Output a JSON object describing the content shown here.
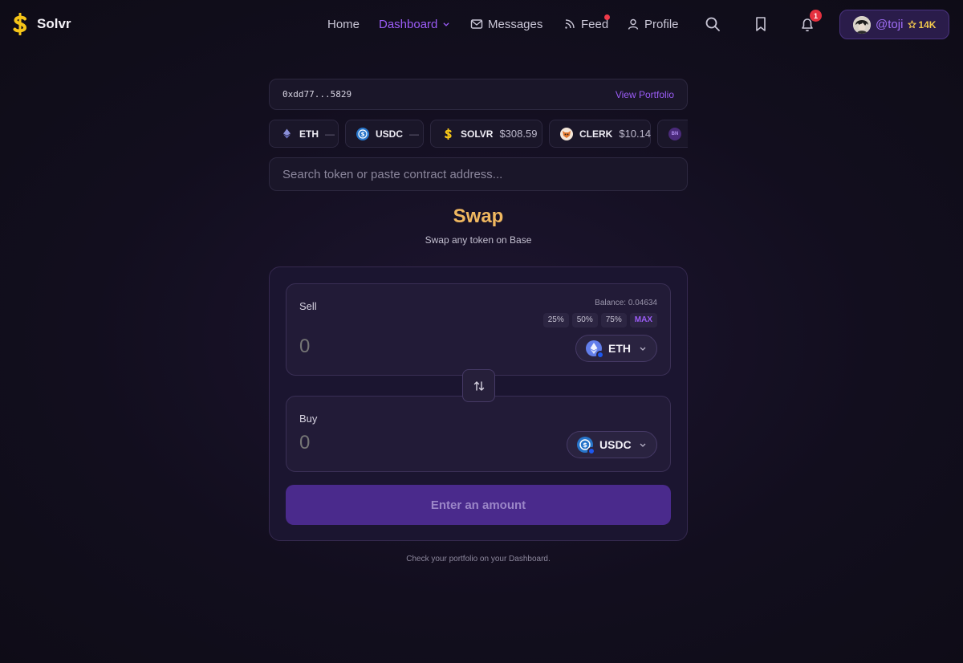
{
  "brand": {
    "name": "Solvr"
  },
  "nav": {
    "home": "Home",
    "dashboard": "Dashboard",
    "messages": "Messages",
    "feed": "Feed",
    "profile": "Profile",
    "notifications_count": "1"
  },
  "user": {
    "handle": "@toji",
    "score": "14K"
  },
  "wallet": {
    "address": "0xdd77...5829",
    "view_portfolio": "View Portfolio"
  },
  "tokens": [
    {
      "symbol": "ETH",
      "price": "—",
      "icon": "eth-icon"
    },
    {
      "symbol": "USDC",
      "price": "—",
      "icon": "usdc-icon"
    },
    {
      "symbol": "SOLVR",
      "price": "$308.59",
      "icon": "solvr-icon"
    },
    {
      "symbol": "CLERK",
      "price": "$10.14",
      "icon": "clerk-icon"
    },
    {
      "symbol": "BN",
      "price": "",
      "icon": "bn-icon"
    }
  ],
  "search": {
    "placeholder": "Search token or paste contract address..."
  },
  "swap": {
    "title": "Swap",
    "subtitle": "Swap any token on Base",
    "sell": {
      "label": "Sell",
      "balance": "Balance: 0.04634",
      "percent_options": [
        "25%",
        "50%",
        "75%",
        "MAX"
      ],
      "amount": "0",
      "token": "ETH"
    },
    "buy": {
      "label": "Buy",
      "amount": "0",
      "token": "USDC"
    },
    "submit_label": "Enter an amount"
  },
  "footer_note": "Check your portfolio on your Dashboard.",
  "colors": {
    "accent": "#9b5cf6",
    "title": "#f0b860",
    "button": "#4a2a8c",
    "notification": "#e5313f"
  }
}
